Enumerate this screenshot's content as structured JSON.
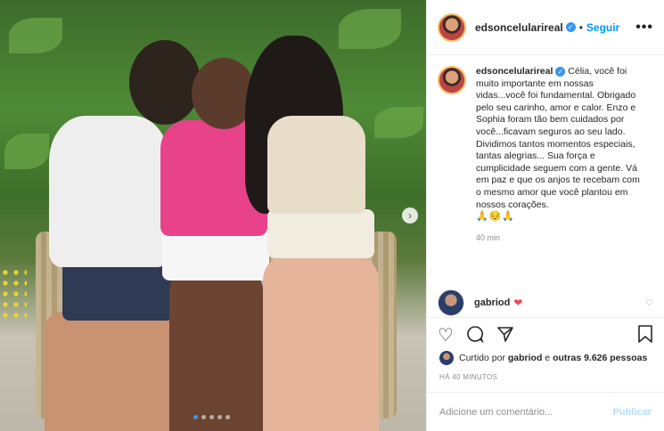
{
  "post": {
    "username": "edsoncelularireal",
    "follow_label": "Seguir",
    "more_label": "•••",
    "verified_mark": "✓",
    "separator": "•"
  },
  "caption": {
    "username": "edsoncelularireal",
    "text": "Célia, você foi muito importante em nossas vidas...você foi fundamental. Obrigado pelo seu carinho, amor e calor. Enzo e Sophia foram tão bem cuidados por você...ficavam seguros ao seu lado. Dividimos tantos momentos especiais, tantas alegrias... Sua força e cumplicidade seguem com a gente. Vá em paz e que os anjos te recebam com o mesmo amor que você plantou em nossos corações.",
    "emoji": "🙏😔🙏",
    "time": "40 min"
  },
  "comment": {
    "username": "gabriod",
    "text": "❤"
  },
  "likes": {
    "prefix": "Curtido por",
    "user": "gabriod",
    "middle": "e",
    "others": "outras 9.626 pessoas"
  },
  "posted": "HÁ 40 MINUTOS",
  "add_comment": {
    "placeholder": "Adicione um comentário...",
    "publish_label": "Publicar"
  },
  "carousel": {
    "count": 5,
    "active_index": 0
  },
  "colors": {
    "accent": "#0095f6",
    "heart": "#ed4956",
    "border": "#efefef"
  },
  "icons": [
    "heart-icon",
    "comment-icon",
    "share-icon",
    "bookmark-icon",
    "chevron-right-icon",
    "verified-icon"
  ]
}
